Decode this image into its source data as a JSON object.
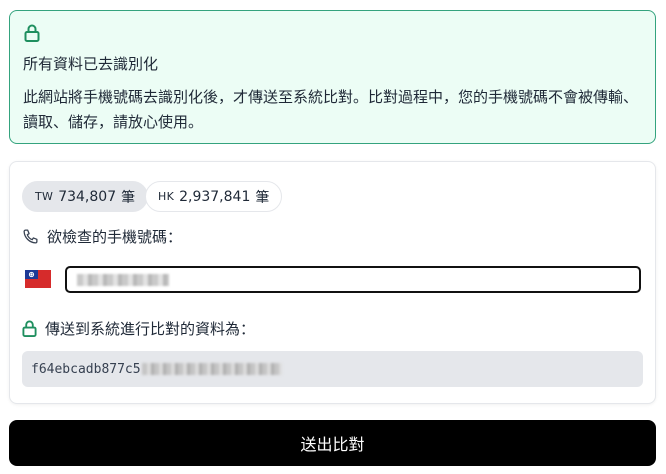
{
  "notice": {
    "title": "所有資料已去識別化",
    "description": "此網站將手機號碼去識別化後，才傳送至系統比對。比對過程中，您的手機號碼不會被傳輸、讀取、儲存，請放心使用。"
  },
  "stats": [
    {
      "code": "TW",
      "count": "734,807",
      "unit": "筆"
    },
    {
      "code": "HK",
      "count": "2,937,841",
      "unit": "筆"
    }
  ],
  "phone": {
    "label": "欲檢查的手機號碼：",
    "flag": "taiwan-flag",
    "value_redacted": true
  },
  "hash": {
    "label": "傳送到系統進行比對的資料為：",
    "prefix": "f64ebcadb877c5"
  },
  "submit_label": "送出比對",
  "colors": {
    "notice_bg": "#ecfdf5",
    "notice_border": "#34a37e",
    "icon_green": "#1f8f5f",
    "button_bg": "#000000"
  }
}
